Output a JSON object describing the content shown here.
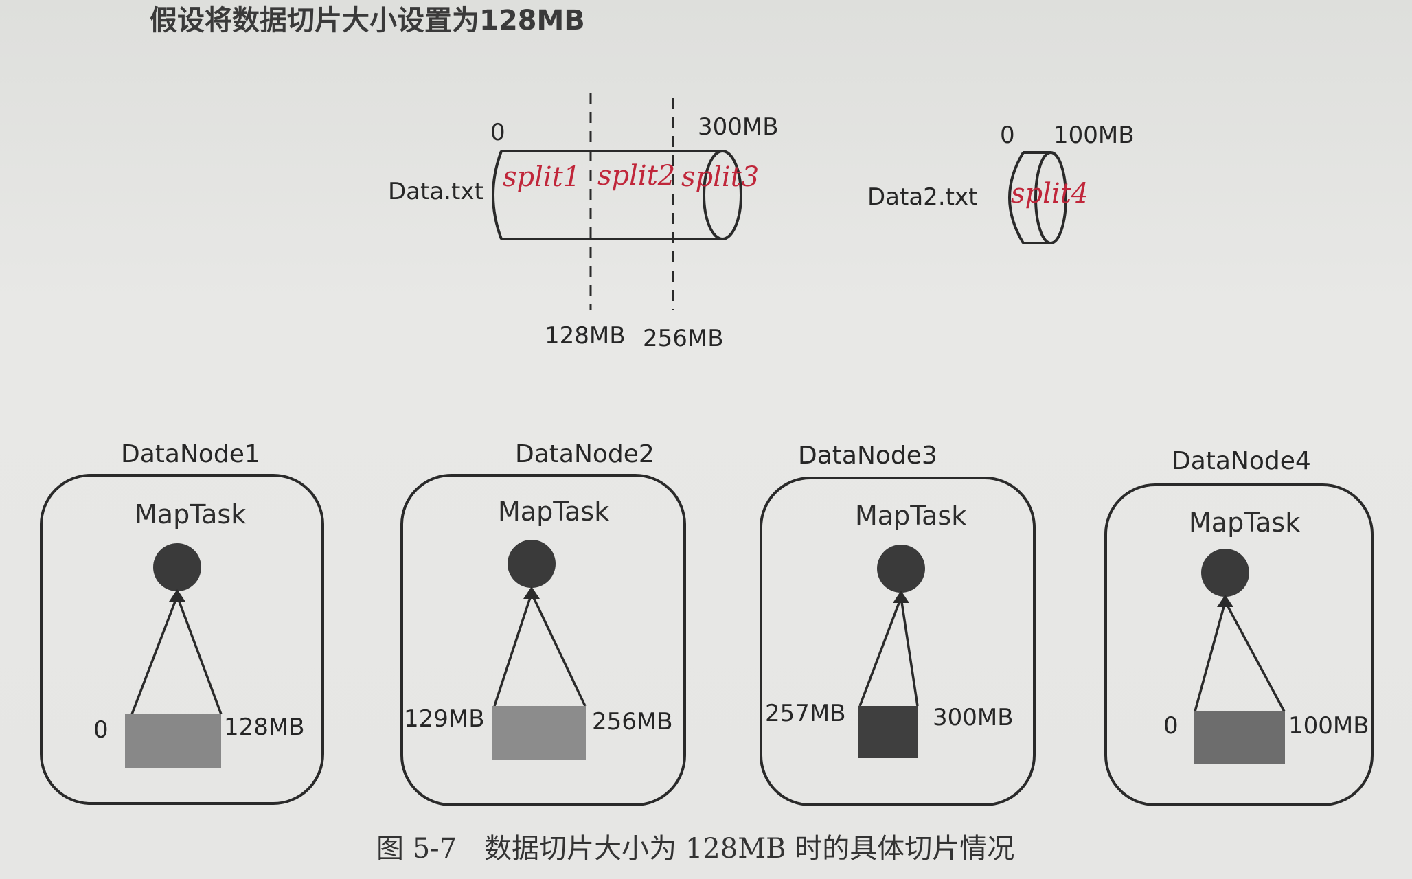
{
  "heading": "假设将数据切片大小设置为128MB",
  "files": [
    {
      "name": "Data.txt",
      "start": "0",
      "end": "300MB",
      "boundaries": [
        "128MB",
        "256MB"
      ],
      "splits": [
        "split1",
        "split2",
        "split3"
      ]
    },
    {
      "name": "Data2.txt",
      "start": "0",
      "end": "100MB",
      "splits": [
        "split4"
      ]
    }
  ],
  "nodes": [
    {
      "title": "DataNode1",
      "task": "MapTask",
      "start": "0",
      "end": "128MB",
      "block_color": "#888888"
    },
    {
      "title": "DataNode2",
      "task": "MapTask",
      "start": "129MB",
      "end": "256MB",
      "block_color": "#8c8c8c"
    },
    {
      "title": "DataNode3",
      "task": "MapTask",
      "start": "257MB",
      "end": "300MB",
      "block_color": "#3f3f3f"
    },
    {
      "title": "DataNode4",
      "task": "MapTask",
      "start": "0",
      "end": "100MB",
      "block_color": "#6d6d6d"
    }
  ],
  "caption": "图 5-7　数据切片大小为 128MB 时的具体切片情况",
  "colors": {
    "ink": "#262626",
    "handwriting": "#c0263a",
    "task_node": "#3a3a3a"
  }
}
